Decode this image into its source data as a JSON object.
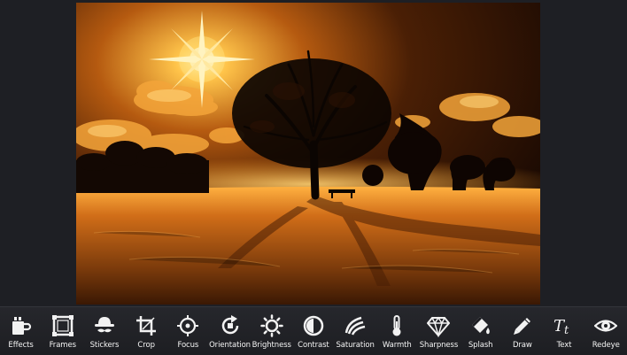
{
  "toolbar": {
    "tools": [
      {
        "label": "Effects",
        "icon": "effects-icon"
      },
      {
        "label": "Frames",
        "icon": "frames-icon"
      },
      {
        "label": "Stickers",
        "icon": "stickers-icon"
      },
      {
        "label": "Crop",
        "icon": "crop-icon"
      },
      {
        "label": "Focus",
        "icon": "focus-icon"
      },
      {
        "label": "Orientation",
        "icon": "orientation-icon"
      },
      {
        "label": "Brightness",
        "icon": "brightness-icon"
      },
      {
        "label": "Contrast",
        "icon": "contrast-icon"
      },
      {
        "label": "Saturation",
        "icon": "saturation-icon"
      },
      {
        "label": "Warmth",
        "icon": "warmth-icon"
      },
      {
        "label": "Sharpness",
        "icon": "sharpness-icon"
      },
      {
        "label": "Splash",
        "icon": "splash-icon"
      },
      {
        "label": "Draw",
        "icon": "draw-icon"
      },
      {
        "label": "Text",
        "icon": "text-icon"
      },
      {
        "label": "Redeye",
        "icon": "redeye-icon"
      }
    ]
  },
  "photo": {
    "subject": "sunset-tree-snow-scene",
    "colors": {
      "sky_dark": "#1a0b03",
      "glow": "#ffb43a",
      "snow": "#c56a1e"
    }
  }
}
